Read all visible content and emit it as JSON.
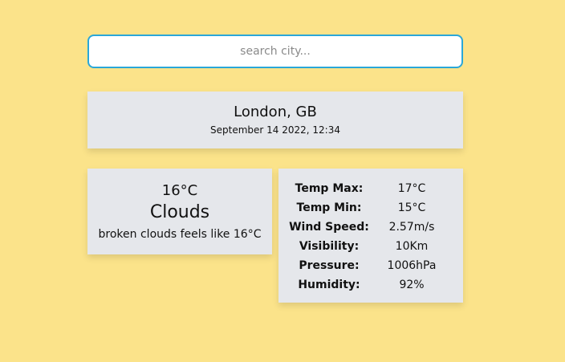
{
  "search": {
    "placeholder": "search city...",
    "value": ""
  },
  "location": {
    "name": "London, GB",
    "datetime": "September 14 2022, 12:34"
  },
  "current": {
    "temperature": "16°C",
    "condition": "Clouds",
    "description": "broken clouds feels like 16°C"
  },
  "details": [
    {
      "label": "Temp Max:",
      "value": "17°C"
    },
    {
      "label": "Temp Min:",
      "value": "15°C"
    },
    {
      "label": "Wind Speed:",
      "value": "2.57m/s"
    },
    {
      "label": "Visibility:",
      "value": "10Km"
    },
    {
      "label": "Pressure:",
      "value": "1006hPa"
    },
    {
      "label": "Humidity:",
      "value": "92%"
    }
  ],
  "colors": {
    "background": "#fbe38a",
    "card": "#e5e7eb",
    "input_border": "#2aa7d8"
  }
}
